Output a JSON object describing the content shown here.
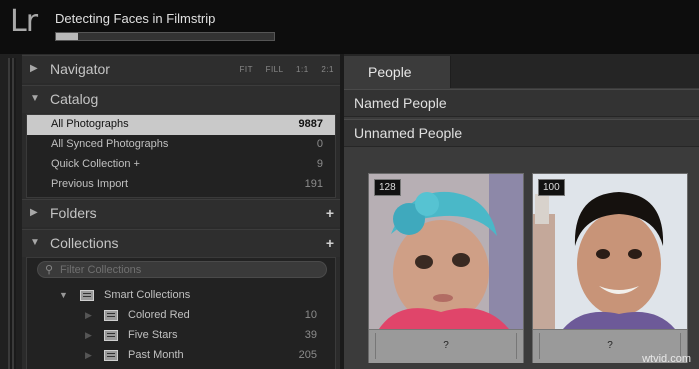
{
  "app": {
    "logo": "Lr"
  },
  "activity": {
    "task": "Detecting Faces in Filmstrip",
    "progress_percent": 10
  },
  "navigator": {
    "title": "Navigator",
    "zoom_options": [
      "FIT",
      "FILL",
      "1:1",
      "2:1"
    ]
  },
  "catalog": {
    "title": "Catalog",
    "items": [
      {
        "label": "All Photographs",
        "count": "9887"
      },
      {
        "label": "All Synced Photographs",
        "count": "0"
      },
      {
        "label": "Quick Collection  +",
        "count": "9"
      },
      {
        "label": "Previous Import",
        "count": "191"
      }
    ]
  },
  "folders": {
    "title": "Folders",
    "add_label": "+"
  },
  "collections": {
    "title": "Collections",
    "add_label": "+",
    "filter_placeholder": "Filter Collections",
    "group": "Smart Collections",
    "items": [
      {
        "label": "Colored Red",
        "count": "10"
      },
      {
        "label": "Five Stars",
        "count": "39"
      },
      {
        "label": "Past Month",
        "count": "205"
      }
    ]
  },
  "people": {
    "tab": "People",
    "named_header": "Named People",
    "unnamed_header": "Unnamed People",
    "faces": [
      {
        "count": "128",
        "name": "?"
      },
      {
        "count": "100",
        "name": "?"
      }
    ]
  },
  "watermark": "wtvid.com",
  "colors": {
    "selection": "#c9c9c9",
    "panel": "#2b2b2b",
    "accent_text": "#e6e6e6"
  }
}
